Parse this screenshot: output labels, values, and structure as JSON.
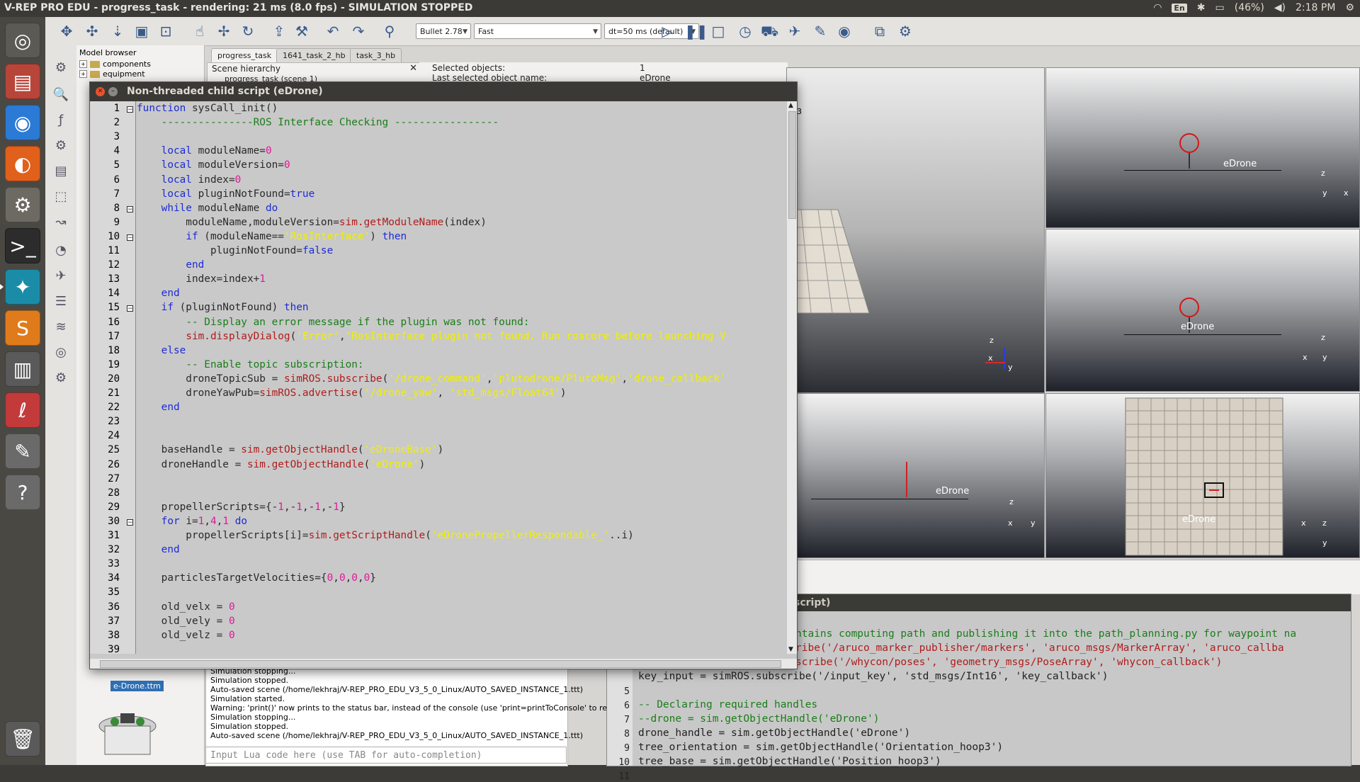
{
  "window_title": "V-REP PRO EDU - progress_task - rendering: 21 ms (8.0 fps) - SIMULATION STOPPED",
  "tray": {
    "lang": "En",
    "battery": "(46%)",
    "time": "2:18 PM"
  },
  "toolbar": {
    "engine": "Bullet 2.78",
    "speed": "Fast",
    "dt": "dt=50 ms (default)"
  },
  "model_browser": {
    "title": "Model browser",
    "items": [
      "components",
      "equipment"
    ]
  },
  "scene_tabs": [
    "progress_task",
    "1641_task_2_hb",
    "task_3_hb"
  ],
  "hierarchy": {
    "title": "Scene hierarchy",
    "item": "progress_task (scene 1)"
  },
  "selection": {
    "selected_label": "Selected objects:",
    "selected_value": "1",
    "last_label": "Last selected object name:",
    "last_value": "eDrone"
  },
  "viewports": {
    "drone_label": "eDrone",
    "axis_x": "x",
    "axis_y": "y",
    "axis_z": "z",
    "corner_number": "3"
  },
  "dialog": {
    "title": "Non-threaded child script (eDrone)",
    "lines": [
      "function sysCall_init()",
      "    ---------------ROS Interface Checking -----------------",
      "",
      "    local moduleName=0",
      "    local moduleVersion=0",
      "    local index=0",
      "    local pluginNotFound=true",
      "    while moduleName do",
      "        moduleName,moduleVersion=sim.getModuleName(index)",
      "        if (moduleName=='RosInterface') then",
      "            pluginNotFound=false",
      "        end",
      "        index=index+1",
      "    end",
      "    if (pluginNotFound) then",
      "        -- Display an error message if the plugin was not found:",
      "        sim.displayDialog('Error','RosInterface plugin not found. Run roscore before launching V",
      "    else",
      "        -- Enable topic subscription:",
      "        droneTopicSub = simROS.subscribe('/drone_command','plutodrone/PlutoMsg','drone_callback'",
      "        droneYawPub=simROS.advertise('/drone_yaw', 'std_msgs/Float64')",
      "    end",
      "",
      "",
      "    baseHandle = sim.getObjectHandle('eDroneBase')",
      "    droneHandle = sim.getObjectHandle('eDrone')",
      "",
      "",
      "    propellerScripts={-1,-1,-1,-1}",
      "    for i=1,4,1 do",
      "        propellerScripts[i]=sim.getScriptHandle('eDronePropellerRespondable_'..i)",
      "    end",
      "",
      "    particlesTargetVelocities={0,0,0,0}",
      "",
      "    old_velx = 0",
      "    old_vely = 0",
      "    old_velz = 0",
      ""
    ]
  },
  "editor2": {
    "title": "script)",
    "lines": [
      "ntains computing path and publishing it into the path_planning.py for waypoint na",
      "ribe('/aruco_marker_publisher/markers', 'aruco_msgs/MarkerArray', 'aruco_callba",
      "scribe('/whycon/poses', 'geometry_msgs/PoseArray', 'whycon_callback')",
      "key_input = simROS.subscribe('/input_key', 'std_msgs/Int16', 'key_callback')",
      "",
      "-- Declaring required handles",
      "--drone = sim.getObjectHandle('eDrone')",
      "drone_handle = sim.getObjectHandle('eDrone')",
      "tree_orientation = sim.getObjectHandle('Orientation_hoop3')",
      "tree_base = sim.getObjectHandle('Position_hoop3')"
    ],
    "line_numbers": [
      "5",
      "6",
      "7",
      "8",
      "9",
      "10",
      "11"
    ]
  },
  "console": {
    "lines": [
      "Simulation stopping...",
      "Simulation stopped.",
      "Auto-saved scene (/home/lekhraj/V-REP_PRO_EDU_V3_5_0_Linux/AUTO_SAVED_INSTANCE_1.ttt)",
      "Simulation started.",
      "Warning: 'print()' now prints to the status bar, instead of the console (use 'print=printToConsole' to re",
      "Simulation stopping...",
      "Simulation stopped.",
      "Auto-saved scene (/home/lekhraj/V-REP_PRO_EDU_V3_5_0_Linux/AUTO_SAVED_INSTANCE_1.ttt)"
    ],
    "input_placeholder": "Input Lua code here (use TAB for auto-completion)"
  },
  "model_thumb_label": "e-Drone.ttm"
}
